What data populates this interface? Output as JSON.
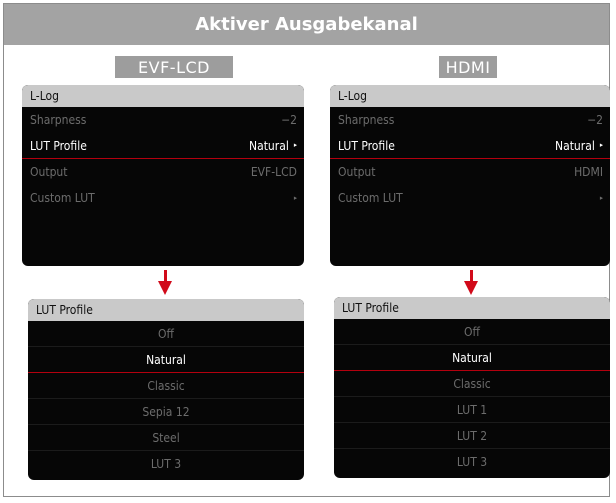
{
  "title": "Aktiver Ausgabekanal",
  "accent_color": "#b3000e",
  "arrow_color": "#d10a1a",
  "columns": [
    {
      "label": "EVF-LCD",
      "menu": {
        "header": "L-Log",
        "rows": [
          {
            "label": "Sharpness",
            "value": "−2",
            "chevron": "",
            "active": false
          },
          {
            "label": "LUT Profile",
            "value": "Natural",
            "chevron": "▸",
            "active": true
          },
          {
            "label": "Output",
            "value": "EVF-LCD",
            "chevron": "",
            "active": false
          },
          {
            "label": "Custom LUT",
            "value": "",
            "chevron": "▸",
            "active": false
          }
        ]
      },
      "lut_list": {
        "header": "LUT Profile",
        "items": [
          "Off",
          "Natural",
          "Classic",
          "Sepia 12",
          "Steel",
          "LUT 3"
        ],
        "selected": "Natural"
      }
    },
    {
      "label": "HDMI",
      "menu": {
        "header": "L-Log",
        "rows": [
          {
            "label": "Sharpness",
            "value": "−2",
            "chevron": "",
            "active": false
          },
          {
            "label": "LUT Profile",
            "value": "Natural",
            "chevron": "▸",
            "active": true
          },
          {
            "label": "Output",
            "value": "HDMI",
            "chevron": "",
            "active": false
          },
          {
            "label": "Custom LUT",
            "value": "",
            "chevron": "▸",
            "active": false
          }
        ]
      },
      "lut_list": {
        "header": "LUT Profile",
        "items": [
          "Off",
          "Natural",
          "Classic",
          "LUT 1",
          "LUT 2",
          "LUT 3"
        ],
        "selected": "Natural"
      }
    }
  ]
}
